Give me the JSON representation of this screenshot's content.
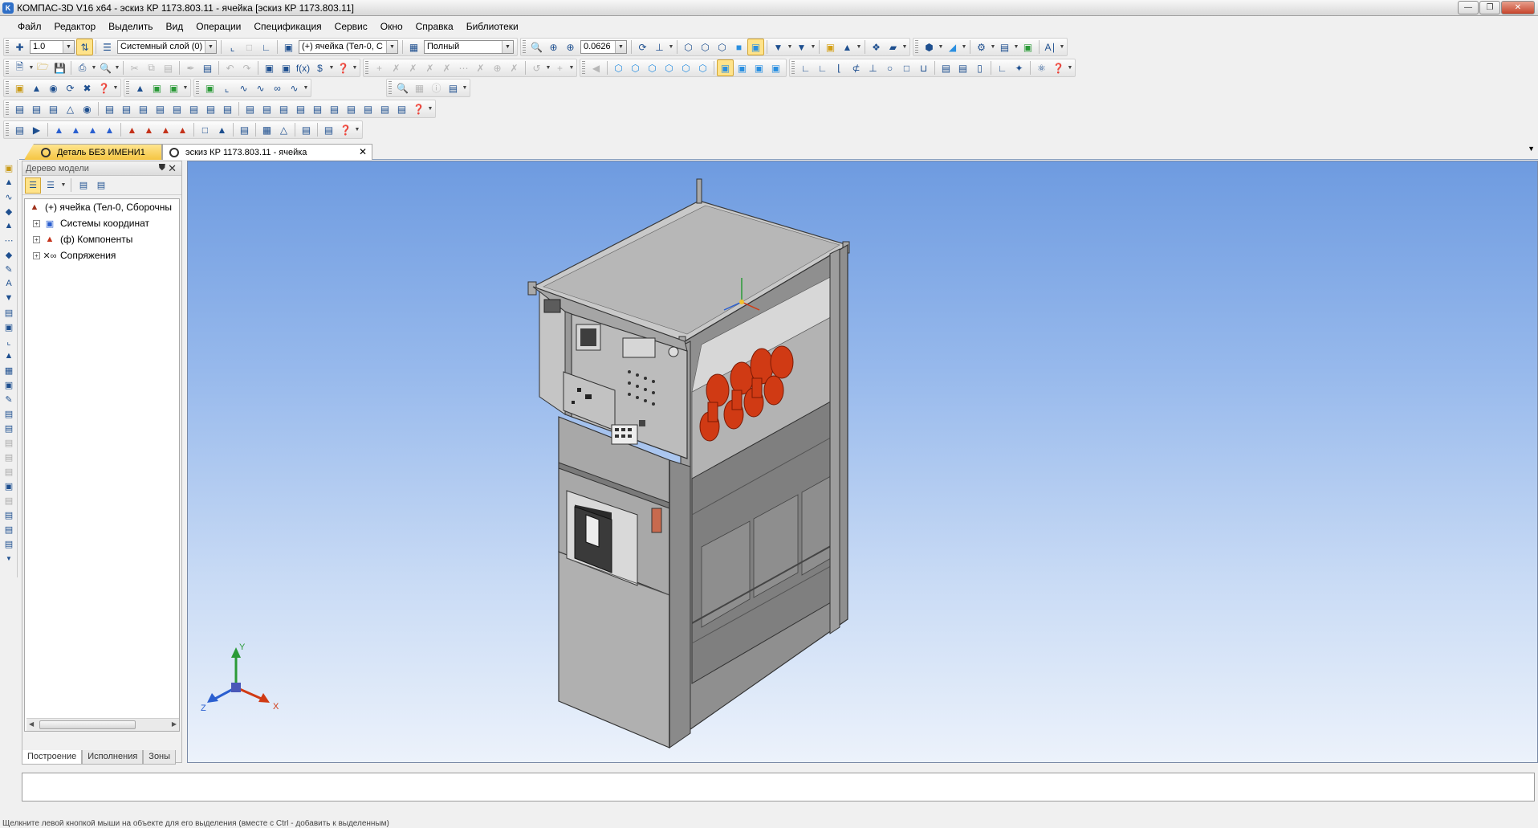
{
  "title": "КОМПАС-3D V16  x64 - эскиз КР 1173.803.11 - ячейка [эскиз КР 1173.803.11]",
  "menu": [
    "Файл",
    "Редактор",
    "Выделить",
    "Вид",
    "Операции",
    "Спецификация",
    "Сервис",
    "Окно",
    "Справка",
    "Библиотеки"
  ],
  "toolbar": {
    "step_value": "1.0",
    "layer": "Системный слой (0)",
    "component": "(+) ячейка (Тел-0, С",
    "display_mode": "Полный",
    "zoom": "0.0626"
  },
  "tabs": [
    {
      "label": "Деталь БЕЗ ИМЕНИ1",
      "active": false
    },
    {
      "label": "эскиз КР 1173.803.11 - ячейка",
      "active": true
    }
  ],
  "panel": {
    "title": "Дерево модели",
    "tree": [
      {
        "label": "(+) ячейка (Тел-0, Сборочны",
        "level": 0,
        "icon": "assembly-icon"
      },
      {
        "label": "Системы координат",
        "level": 1,
        "icon": "coordinate-systems-icon"
      },
      {
        "label": "(ф) Компоненты",
        "level": 1,
        "icon": "components-icon"
      },
      {
        "label": "Сопряжения",
        "level": 1,
        "icon": "mates-icon"
      }
    ],
    "bottom_tabs": [
      "Построение",
      "Исполнения",
      "Зоны"
    ]
  },
  "axes": {
    "x": "X",
    "y": "Y",
    "z": "Z"
  },
  "status": "Щелкните левой кнопкой мыши на объекте для его выделения (вместе с Ctrl - добавить к выделенным)",
  "colors": {
    "accent_tab": "#f5c542",
    "viewport_top": "#6e9be0",
    "viewport_bottom": "#ecf2fb",
    "insulator": "#d03a14"
  }
}
